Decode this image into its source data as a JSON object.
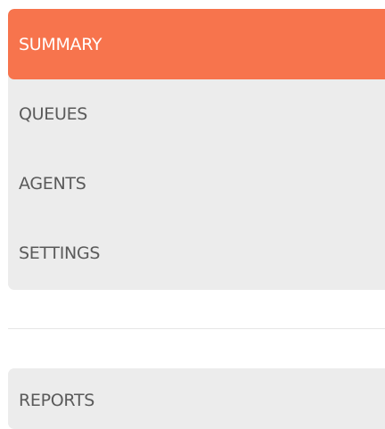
{
  "nav": {
    "items": [
      {
        "label": "SUMMARY",
        "active": true
      },
      {
        "label": "QUEUES",
        "active": false
      },
      {
        "label": "AGENTS",
        "active": false
      },
      {
        "label": "SETTINGS",
        "active": false
      }
    ],
    "secondary": [
      {
        "label": "REPORTS",
        "active": false
      }
    ]
  },
  "colors": {
    "accent": "#f7744d",
    "item_background": "#ececec",
    "text": "#5a5a5a",
    "active_text": "#ffffff"
  }
}
